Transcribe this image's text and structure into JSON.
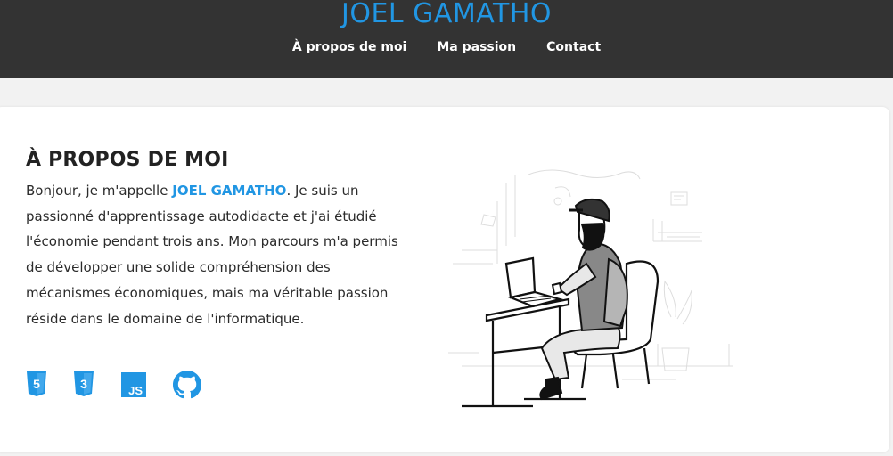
{
  "header": {
    "site_title": "JOEL GAMATHO",
    "nav": [
      {
        "label": "À propos de moi"
      },
      {
        "label": "Ma passion"
      },
      {
        "label": "Contact"
      }
    ]
  },
  "about": {
    "title": "À PROPOS DE MOI",
    "text_before": "Bonjour, je m'appelle ",
    "name": "JOEL GAMATHO",
    "text_after": ". Je suis un passionné d'apprentissage autodidacte et j'ai étudié l'économie pendant trois ans. Mon parcours m'a permis de développer une solide compréhension des mécanismes économiques, mais ma véritable passion réside dans le domaine de l'informatique.",
    "icons": [
      {
        "name": "html5-icon",
        "label": "5"
      },
      {
        "name": "css3-icon",
        "label": "3"
      },
      {
        "name": "javascript-icon",
        "label": "JS"
      },
      {
        "name": "github-icon"
      }
    ]
  },
  "colors": {
    "accent": "#2196e3",
    "header_bg": "#333333",
    "page_bg": "#f2f2f2"
  }
}
